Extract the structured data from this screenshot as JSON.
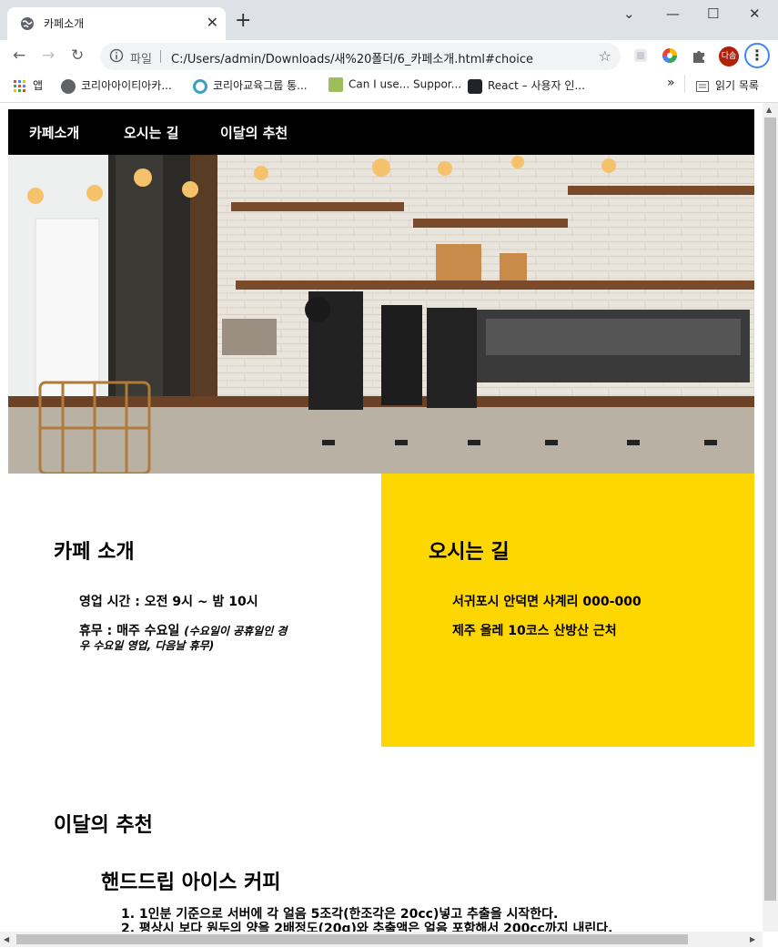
{
  "browser": {
    "tab_title": "카페소개",
    "new_tab_symbol": "+",
    "close_symbol": "✕",
    "window": {
      "minimize": "—",
      "maximize": "☐",
      "close": "✕",
      "dropdown": "⌄"
    },
    "address_label": "파일",
    "url": "C:/Users/admin/Downloads/새%20폴더/6_카페소개.html#choice",
    "avatar_text": "다솜",
    "menu_symbol": "⋮"
  },
  "bookmarks": {
    "items": [
      {
        "label": "앱"
      },
      {
        "label": "코리아아이티아카..."
      },
      {
        "label": "코리아교육그룹 통..."
      },
      {
        "label": "Can I use... Suppor..."
      },
      {
        "label": "React – 사용자 인..."
      }
    ],
    "overflow": "»",
    "reading_list": "읽기 목록"
  },
  "nav": {
    "items": [
      "카페소개",
      "오시는 길",
      "이달의 추천"
    ]
  },
  "intro": {
    "heading": "카페 소개",
    "hours": "영업 시간 : 오전 9시 ~ 밤 10시",
    "closed": "휴무 : 매주 수요일",
    "note_line1": "(수요일이 공휴일인 경",
    "note_line2": "우 수요일 영업, 다음날 휴무)"
  },
  "directions": {
    "heading": "오시는 길",
    "address1": "서귀포시 안덕면 사계리 000-000",
    "address2": "제주 올레 10코스 산방산 근처"
  },
  "recommend": {
    "heading": "이달의 추천",
    "subheading": "핸드드립 아이스 커피",
    "steps": [
      "1. 1인분 기준으로 서버에 각 얼음 5조각(한조각은 20cc)넣고 추출을 시작한다.",
      "2. 평상시 보다 원두의 양을 2배정도(20g)와 추출액은 얼음 포함해서 200cc까지 내린다."
    ]
  },
  "colors": {
    "nav_bg": "#000000",
    "directions_bg": "#ffd700"
  }
}
